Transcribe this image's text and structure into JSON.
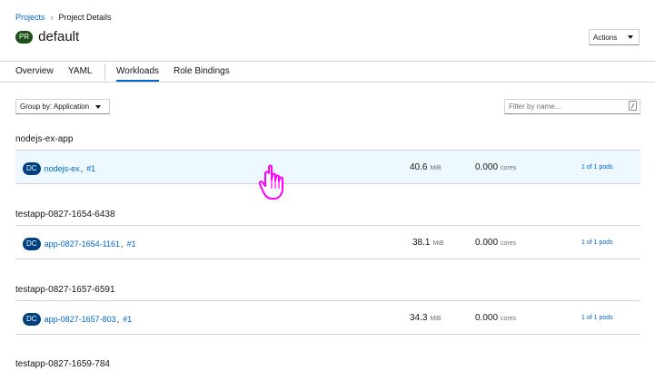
{
  "breadcrumb": {
    "parent": "Projects",
    "separator": "›",
    "current": "Project Details"
  },
  "header": {
    "badge": "PR",
    "title": "default",
    "actions_label": "Actions"
  },
  "tabs": [
    {
      "label": "Overview"
    },
    {
      "label": "YAML"
    },
    {
      "label": "Workloads",
      "active": true
    },
    {
      "label": "Role Bindings"
    }
  ],
  "toolbar": {
    "group_by_label": "Group by: Application",
    "filter_placeholder": "Filter by name...",
    "filter_shortcut": "/"
  },
  "groups": [
    {
      "title": "nodejs-ex-app",
      "row": {
        "kind_badge": "DC",
        "name": "nodejs-ex",
        "sep": ",",
        "revision": "#1",
        "memory": "40.6",
        "memory_unit": "MiB",
        "cpu": "0.000",
        "cpu_unit": "cores",
        "pods": "1 of 1 pods"
      }
    },
    {
      "title": "testapp-0827-1654-6438",
      "row": {
        "kind_badge": "DC",
        "name": "app-0827-1654-1161",
        "sep": ",",
        "revision": "#1",
        "memory": "38.1",
        "memory_unit": "MiB",
        "cpu": "0.000",
        "cpu_unit": "cores",
        "pods": "1 of 1 pods"
      }
    },
    {
      "title": "testapp-0827-1657-6591",
      "row": {
        "kind_badge": "DC",
        "name": "app-0827-1657-803",
        "sep": ",",
        "revision": "#1",
        "memory": "34.3",
        "memory_unit": "MiB",
        "cpu": "0.000",
        "cpu_unit": "cores",
        "pods": "1 of 1 pods"
      }
    },
    {
      "title": "testapp-0827-1659-784"
    }
  ],
  "colors": {
    "link": "#0066cc",
    "project_badge": "#1e4f18",
    "dc_badge": "#004080",
    "hover_row": "#edf8ff",
    "cursor": "#ff00ff"
  },
  "icons": {
    "cursor": "pointer-hand-icon"
  }
}
